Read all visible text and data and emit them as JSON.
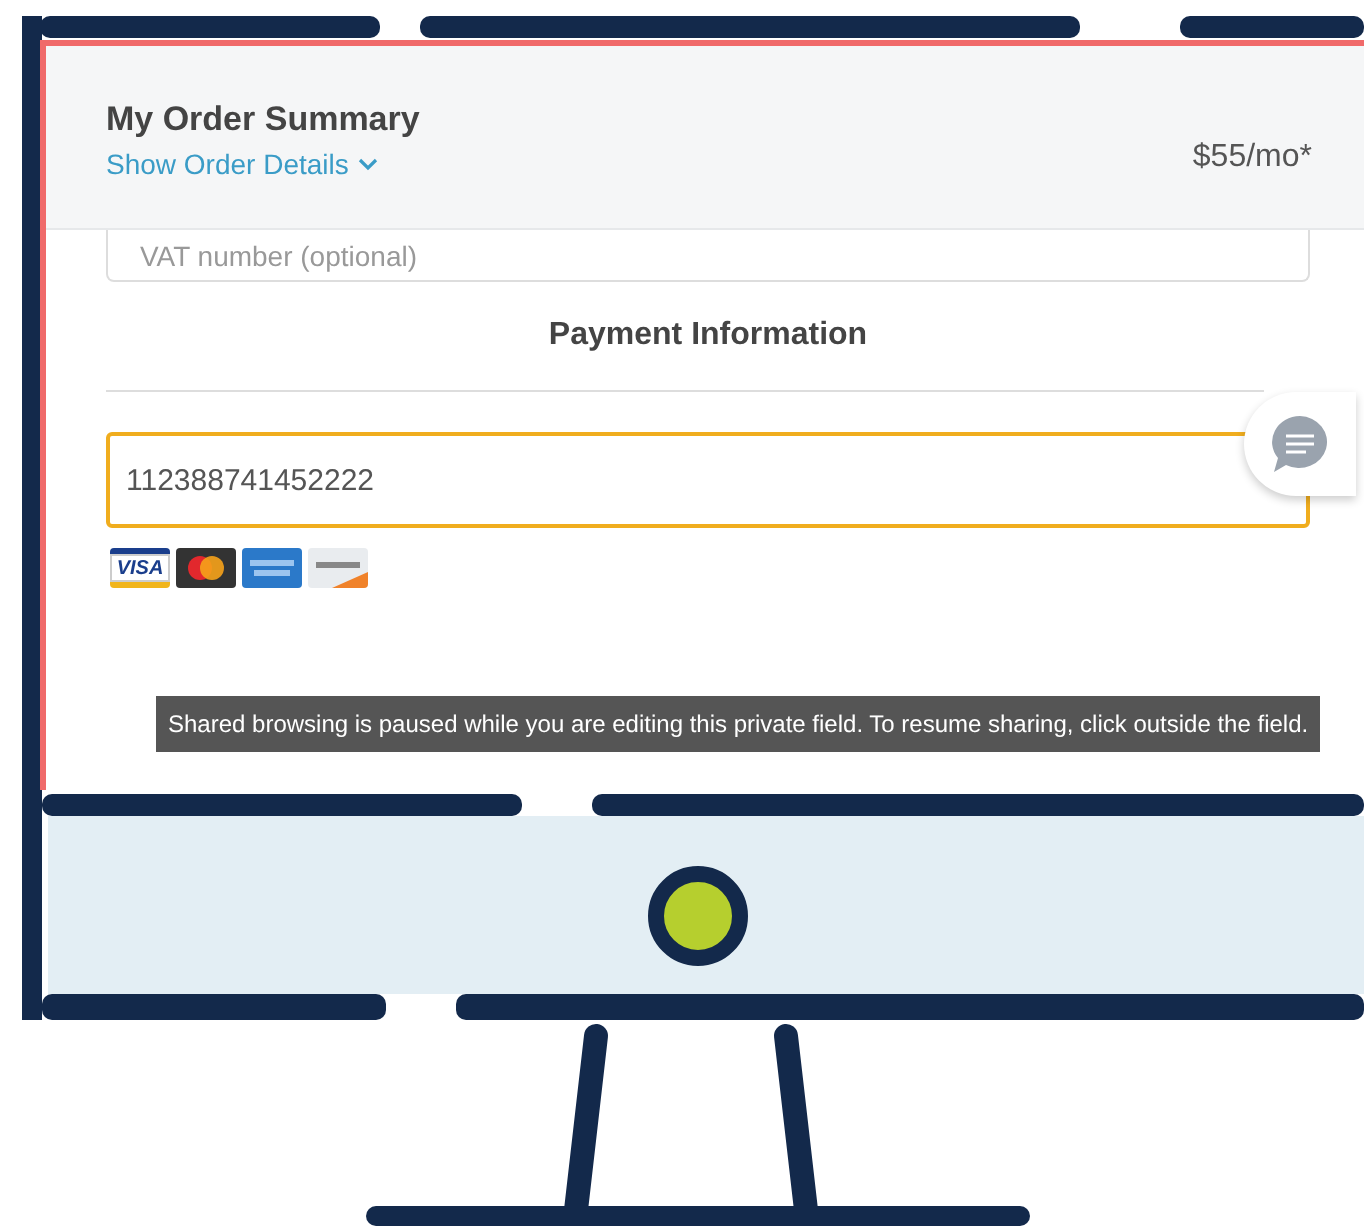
{
  "order_summary": {
    "title": "My Order Summary",
    "details_link": "Show Order Details",
    "price": "$55/mo*"
  },
  "form": {
    "vat_field": {
      "placeholder": "VAT number (optional)"
    },
    "section_title": "Payment Information",
    "card_field": {
      "value": "112388741452222",
      "focused": true
    },
    "card_logos": [
      {
        "kind": "visa",
        "label": "VISA"
      },
      {
        "kind": "mastercard"
      },
      {
        "kind": "amex"
      },
      {
        "kind": "discover"
      }
    ]
  },
  "tooltip": {
    "text": "Shared browsing is paused while you are editing this private field. To resume sharing, click outside the field."
  }
}
